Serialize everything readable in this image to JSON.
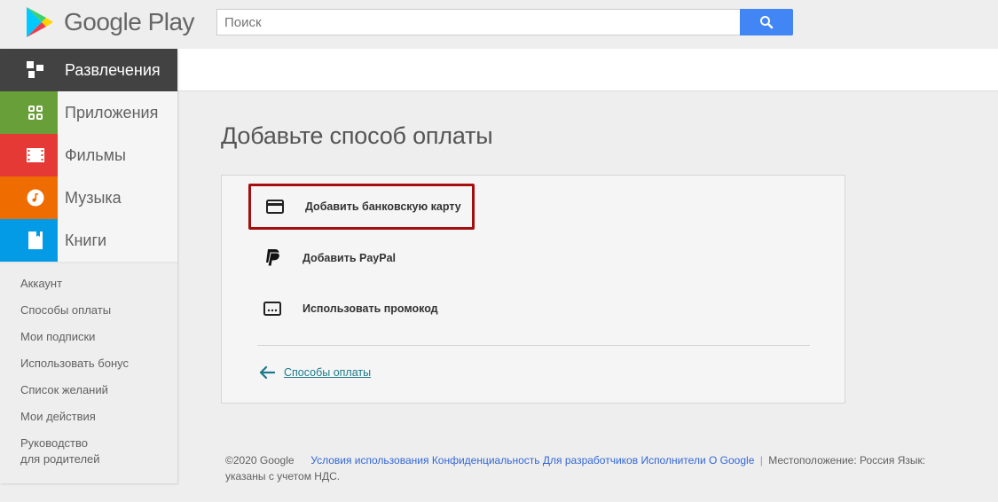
{
  "header": {
    "brand": "Google Play",
    "search_placeholder": "Поиск",
    "search_value": "",
    "search_button_icon": "search-icon",
    "colors": {
      "search_button": "#4285f4"
    }
  },
  "sidebar": {
    "categories": [
      {
        "label": "Развлечения",
        "icon": "entertainment-icon",
        "color": "#424242",
        "active": true
      },
      {
        "label": "Приложения",
        "icon": "apps-grid-icon",
        "color": "#689f38"
      },
      {
        "label": "Фильмы",
        "icon": "film-icon",
        "color": "#e53935"
      },
      {
        "label": "Музыка",
        "icon": "music-note-icon",
        "color": "#ef6c00"
      },
      {
        "label": "Книги",
        "icon": "book-icon",
        "color": "#039be5"
      }
    ],
    "links": [
      "Аккаунт",
      "Способы оплаты",
      "Мои подписки",
      "Использовать бонус",
      "Список желаний",
      "Мои действия",
      "Руководство для родителей"
    ]
  },
  "main": {
    "title": "Добавьте способ оплаты",
    "options": [
      {
        "label": "Добавить банковскую карту",
        "icon": "credit-card-icon",
        "highlighted": true
      },
      {
        "label": "Добавить PayPal",
        "icon": "paypal-icon"
      },
      {
        "label": "Использовать промокод",
        "icon": "promo-code-icon"
      }
    ],
    "back_link": "Способы оплаты",
    "colors": {
      "highlight_border": "#a50e0e",
      "back_link": "#1d7a8a"
    }
  },
  "footer": {
    "copyright": "©2020 Google",
    "links": [
      "Условия использования",
      "Конфиденциальность",
      "Для разработчиков",
      "Исполнители",
      "О Google"
    ],
    "separator": "|",
    "location": "Местоположение: Россия",
    "language": "Язык: ",
    "line2": "указаны с учетом НДС."
  }
}
